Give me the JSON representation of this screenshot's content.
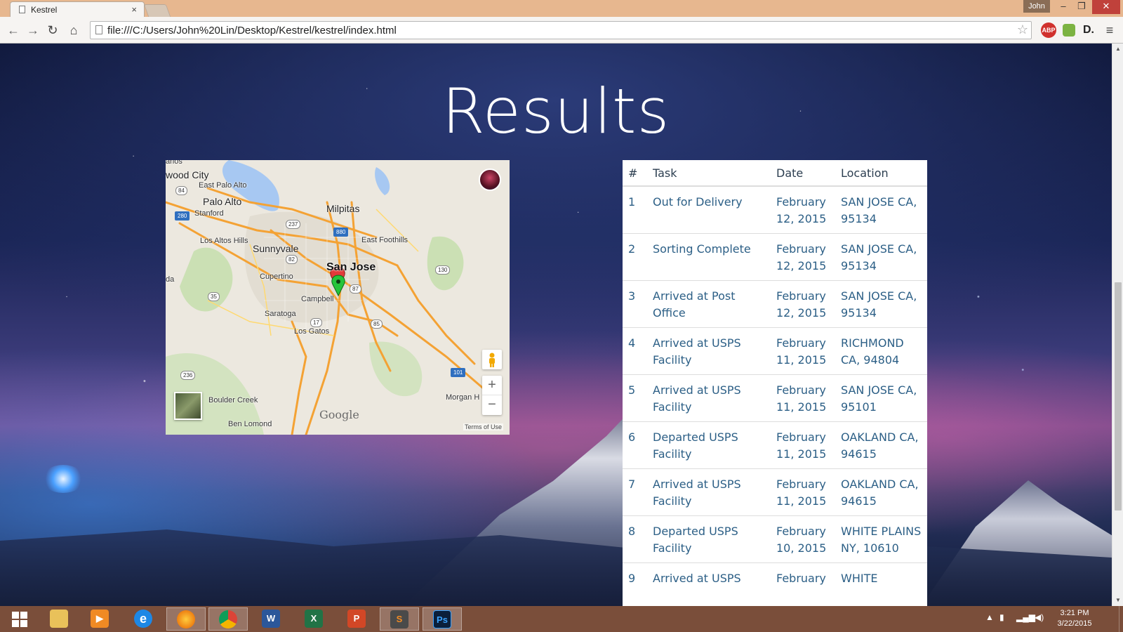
{
  "browser": {
    "tab_title": "Kestrel",
    "user_name": "John",
    "url": "file:///C:/Users/John%20Lin/Desktop/Kestrel/kestrel/index.html",
    "extensions": [
      "ABP",
      "",
      "D."
    ]
  },
  "page": {
    "title": "Results"
  },
  "map": {
    "labels": {
      "redwood_city": "wood City",
      "east_palo_alto": "East Palo Alto",
      "palo_alto": "Palo Alto",
      "stanford": "Stanford",
      "milpitas": "Milpitas",
      "east_foothills": "East Foothills",
      "los_altos_hills": "Los Altos Hills",
      "sunnyvale": "Sunnyvale",
      "san_jose": "San Jose",
      "cupertino": "Cupertino",
      "campbell": "Campbell",
      "saratoga": "Saratoga",
      "los_gatos": "Los Gatos",
      "boulder_creek": "Boulder Creek",
      "ben_lomond": "Ben Lomond",
      "morgan_hill": "Morgan H",
      "carlos": "arlos",
      "left_edge": "da"
    },
    "shields": [
      "84",
      "280",
      "237",
      "880",
      "82",
      "130",
      "87",
      "35",
      "17",
      "85",
      "236",
      "101"
    ],
    "google": "Google",
    "terms": "Terms of Use",
    "zoom_in": "+",
    "zoom_out": "−"
  },
  "table": {
    "headers": {
      "num": "#",
      "task": "Task",
      "date": "Date",
      "location": "Location"
    },
    "rows": [
      {
        "num": "1",
        "task": "Out for Delivery",
        "date": "February 12, 2015",
        "location": "SAN JOSE CA, 95134"
      },
      {
        "num": "2",
        "task": "Sorting Complete",
        "date": "February 12, 2015",
        "location": "SAN JOSE CA, 95134"
      },
      {
        "num": "3",
        "task": "Arrived at Post Office",
        "date": "February 12, 2015",
        "location": "SAN JOSE CA, 95134"
      },
      {
        "num": "4",
        "task": "Arrived at USPS Facility",
        "date": "February 11, 2015",
        "location": "RICHMOND CA, 94804"
      },
      {
        "num": "5",
        "task": "Arrived at USPS Facility",
        "date": "February 11, 2015",
        "location": "SAN JOSE CA, 95101"
      },
      {
        "num": "6",
        "task": "Departed USPS Facility",
        "date": "February 11, 2015",
        "location": "OAKLAND CA, 94615"
      },
      {
        "num": "7",
        "task": "Arrived at USPS Facility",
        "date": "February 11, 2015",
        "location": "OAKLAND CA, 94615"
      },
      {
        "num": "8",
        "task": "Departed USPS Facility",
        "date": "February 10, 2015",
        "location": "WHITE PLAINS NY, 10610"
      },
      {
        "num": "9",
        "task": "Arrived at USPS",
        "date": "February",
        "location": "WHITE"
      }
    ]
  },
  "taskbar": {
    "apps": [
      "file-explorer",
      "media-player",
      "internet-explorer",
      "firefox",
      "chrome",
      "word",
      "excel",
      "powerpoint",
      "sublime-text",
      "photoshop"
    ],
    "app_glyphs": {
      "word": "W",
      "excel": "X",
      "powerpoint": "P",
      "sublime": "S",
      "photoshop": "Ps",
      "ie": "e"
    },
    "clock_time": "3:21 PM",
    "clock_date": "3/22/2015"
  },
  "colors": {
    "titlebar": "#e7b78f",
    "taskbar": "#7a4e3a",
    "table_link": "#2c5f86",
    "title_text": "#ffffff"
  }
}
